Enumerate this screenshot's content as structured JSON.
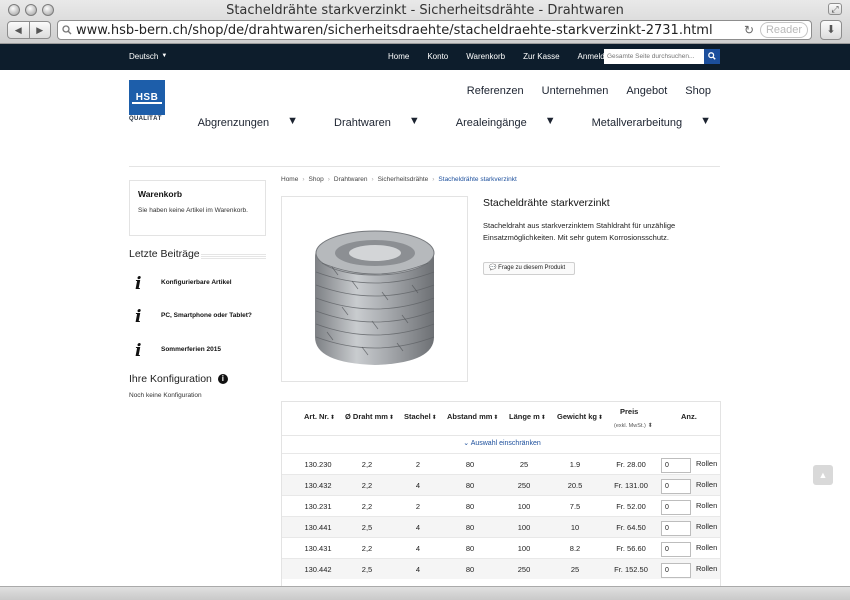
{
  "browser": {
    "window_title": "Stacheldrähte starkverzinkt - Sicherheitsdrähte - Drahtwaren",
    "url": "www.hsb-bern.ch/shop/de/drahtwaren/sicherheitsdraehte/stacheldraehte-starkverzinkt-2731.html",
    "reader_label": "Reader",
    "back_icon": "◀",
    "forward_icon": "▶",
    "reload_icon": "↻",
    "download_icon": "⬇",
    "resize_icon": "⤢"
  },
  "topnav": {
    "language": "Deutsch",
    "links": [
      "Home",
      "Konto",
      "Warenkorb",
      "Zur Kasse",
      "Anmelden"
    ],
    "search_placeholder": "Gesamte Seite durchsuchen...",
    "search_button_icon": "🔍"
  },
  "logo": {
    "text": "HSB",
    "tagline": "QUALITÄT"
  },
  "mainnav": {
    "primary": [
      "Referenzen",
      "Unternehmen",
      "Angebot",
      "Shop"
    ],
    "secondary": [
      "Abgrenzungen",
      "Drahtwaren",
      "Arealeingänge",
      "Metallverarbeitung"
    ]
  },
  "sidebar": {
    "cart_title": "Warenkorb",
    "cart_text": "Sie haben keine Artikel im Warenkorb.",
    "recent_title": "Letzte Beiträge",
    "posts": [
      "Konfigurierbare Artikel",
      "PC, Smartphone oder Tablet?",
      "Sommerferien 2015"
    ],
    "config_title": "Ihre Konfiguration",
    "config_text": "Noch keine Konfiguration"
  },
  "breadcrumb": [
    "Home",
    "Shop",
    "Drahtwaren",
    "Sicherheitsdrähte",
    "Stacheldrähte starkverzinkt"
  ],
  "product": {
    "title": "Stacheldrähte starkverzinkt",
    "description": "Stacheldraht aus starkverzinktem Stahldraht für unzählige Einsatzmöglichkeiten. Mit sehr gutem Korrosionsschutz.",
    "question_button": "Frage zu diesem Produkt"
  },
  "table": {
    "headers": [
      "Art. Nr.",
      "Ø Draht mm",
      "Stachel",
      "Abstand mm",
      "Länge m",
      "Gewicht kg",
      "Preis",
      "Anz."
    ],
    "price_sub": "(exkl. MwSt.)",
    "filter_label": "Auswahl einschränken",
    "rows": [
      {
        "art": "130.230",
        "draht": "2,2",
        "stachel": "2",
        "abstand": "80",
        "laenge": "25",
        "gewicht": "1.9",
        "preis": "Fr. 28.00",
        "qty": "0",
        "unit": "Rollen"
      },
      {
        "art": "130.432",
        "draht": "2,2",
        "stachel": "4",
        "abstand": "80",
        "laenge": "250",
        "gewicht": "20.5",
        "preis": "Fr. 131.00",
        "qty": "0",
        "unit": "Rollen"
      },
      {
        "art": "130.231",
        "draht": "2,2",
        "stachel": "2",
        "abstand": "80",
        "laenge": "100",
        "gewicht": "7.5",
        "preis": "Fr. 52.00",
        "qty": "0",
        "unit": "Rollen"
      },
      {
        "art": "130.441",
        "draht": "2,5",
        "stachel": "4",
        "abstand": "80",
        "laenge": "100",
        "gewicht": "10",
        "preis": "Fr. 64.50",
        "qty": "0",
        "unit": "Rollen"
      },
      {
        "art": "130.431",
        "draht": "2,2",
        "stachel": "4",
        "abstand": "80",
        "laenge": "100",
        "gewicht": "8.2",
        "preis": "Fr. 56.60",
        "qty": "0",
        "unit": "Rollen"
      },
      {
        "art": "130.442",
        "draht": "2,5",
        "stachel": "4",
        "abstand": "80",
        "laenge": "250",
        "gewicht": "25",
        "preis": "Fr. 152.50",
        "qty": "0",
        "unit": "Rollen"
      }
    ]
  },
  "colors": {
    "topnav_bg": "#0d1d2c",
    "accent": "#1c4f9c",
    "logo_blue": "#1d5eaa"
  }
}
